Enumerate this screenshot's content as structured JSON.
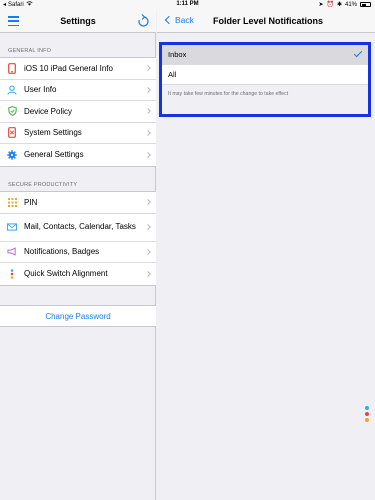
{
  "status_bar": {
    "carrier": "Safari",
    "time": "1:11 PM",
    "battery": "41%"
  },
  "master": {
    "title": "Settings",
    "sections": [
      {
        "header": "GENERAL INFO",
        "items": [
          {
            "label": "iOS 10 iPad  General Info",
            "icon": "phone-icon"
          },
          {
            "label": "User Info",
            "icon": "user-icon"
          },
          {
            "label": "Device Policy",
            "icon": "shield-icon"
          },
          {
            "label": "System Settings",
            "icon": "device-settings-icon"
          },
          {
            "label": "General Settings",
            "icon": "gear-icon"
          }
        ]
      },
      {
        "header": "SECURE PRODUCTIVITY",
        "items": [
          {
            "label": "PIN",
            "icon": "keypad-icon"
          },
          {
            "label": "Mail, Contacts, Calendar, Tasks",
            "icon": "mail-icon"
          },
          {
            "label": "Notifications, Badges",
            "icon": "megaphone-icon"
          },
          {
            "label": "Quick Switch Alignment",
            "icon": "dots-icon"
          }
        ]
      }
    ],
    "change_password": "Change Password"
  },
  "detail": {
    "back_label": "Back",
    "title": "Folder Level Notifications",
    "options": [
      {
        "label": "Inbox",
        "selected": true
      },
      {
        "label": "All",
        "selected": false
      }
    ],
    "footer_note": "It may take few minutes for the change to take effect"
  },
  "colors": {
    "accent": "#1a7cf4",
    "highlight_border": "#1533e0",
    "selected_row": "#d9d9de",
    "background": "#efeff4"
  }
}
